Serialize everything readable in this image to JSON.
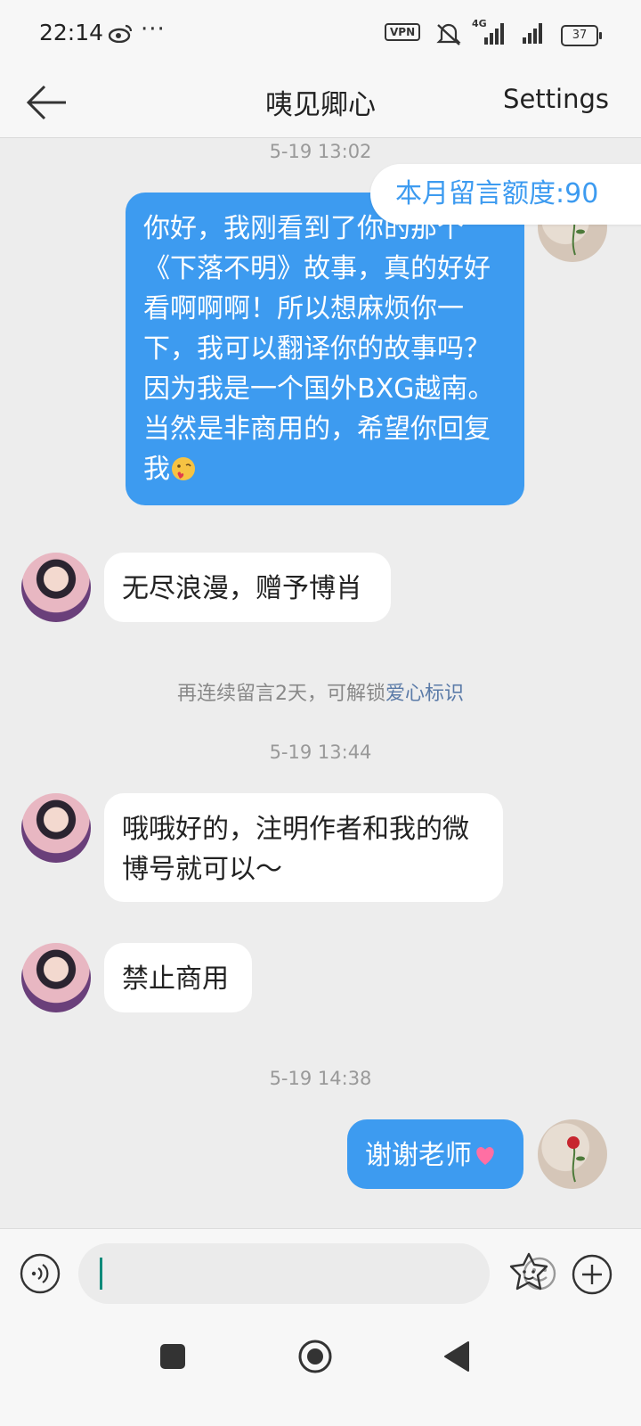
{
  "status_bar": {
    "time": "22:14",
    "more": "···",
    "vpn": "VPN",
    "network": "4G",
    "battery": "37"
  },
  "header": {
    "title": "咦见卿心",
    "settings": "Settings"
  },
  "quota_badge": "本月留言额度:90",
  "messages": [
    {
      "type": "timestamp",
      "text": "5-19 13:02"
    },
    {
      "type": "outgoing",
      "text": "你好，我刚看到了你的那个《下落不明》故事，真的好好看啊啊啊！所以想麻烦你一下，我可以翻译你的故事吗？因为我是一个国外BXG越南。当然是非商用的，希望你回复我",
      "emoji": "kiss-face"
    },
    {
      "type": "incoming",
      "text": "无尽浪漫，赠予博肖"
    },
    {
      "type": "notice",
      "text": "再连续留言2天，可解锁",
      "link": "爱心标识"
    },
    {
      "type": "timestamp",
      "text": "5-19 13:44"
    },
    {
      "type": "incoming",
      "text": "哦哦好的，注明作者和我的微博号就可以～"
    },
    {
      "type": "incoming",
      "text": "禁止商用"
    },
    {
      "type": "timestamp",
      "text": "5-19 14:38"
    },
    {
      "type": "outgoing",
      "text": "谢谢老师",
      "emoji": "heart"
    }
  ],
  "input": {
    "placeholder": ""
  },
  "colors": {
    "accent": "#3d9bf0",
    "background": "#ededed",
    "link": "#5b7ba8"
  },
  "icons": {
    "back": "arrow-left-icon",
    "voice": "voice-icon",
    "emoji": "emoji-icon",
    "sticker": "sticker-icon",
    "plus": "plus-icon"
  }
}
